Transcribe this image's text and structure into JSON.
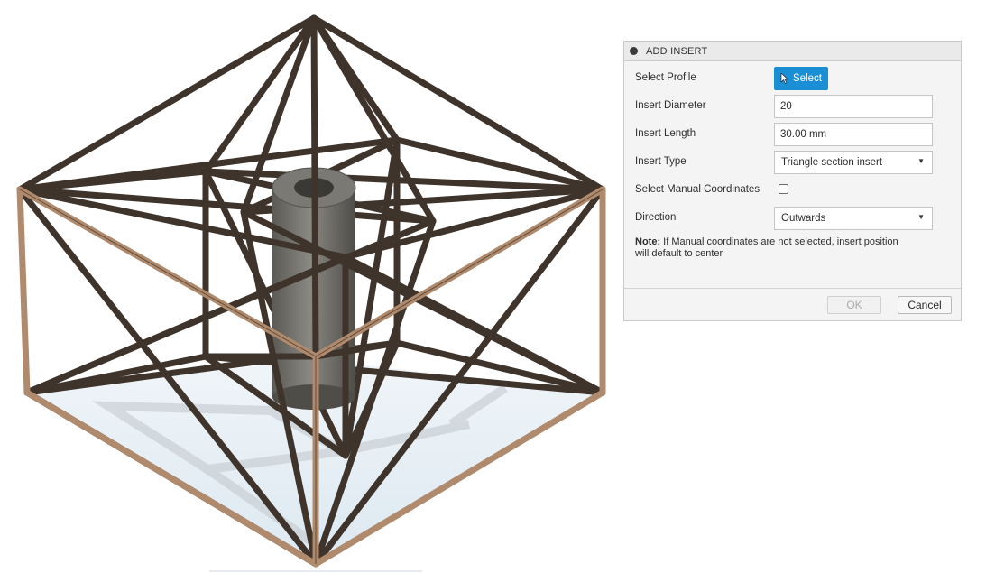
{
  "panel": {
    "title": "ADD INSERT",
    "fields": {
      "select_profile": {
        "label": "Select Profile",
        "button_label": "Select"
      },
      "insert_diameter": {
        "label": "Insert Diameter",
        "value": "20"
      },
      "insert_length": {
        "label": "Insert Length",
        "value": "30.00 mm"
      },
      "insert_type": {
        "label": "Insert Type",
        "value": "Triangle section insert"
      },
      "manual_coordinates": {
        "label": "Select Manual Coordinates",
        "checked": false
      },
      "direction": {
        "label": "Direction",
        "value": "Outwards"
      }
    },
    "note": {
      "prefix": "Note:",
      "text": " If Manual coordinates are not selected, insert position will default to center"
    },
    "buttons": {
      "ok": "OK",
      "cancel": "Cancel"
    }
  },
  "icons": {
    "collapse": "collapse-minus-icon",
    "cursor": "cursor-arrow-icon",
    "caret": "chevron-down-icon"
  },
  "colors": {
    "accent": "#1b8fd6",
    "strut_dark": "#3f342b",
    "strut_light": "#b08a6c",
    "cylinder": "#6f6d67",
    "ground": "#dde9f2"
  }
}
